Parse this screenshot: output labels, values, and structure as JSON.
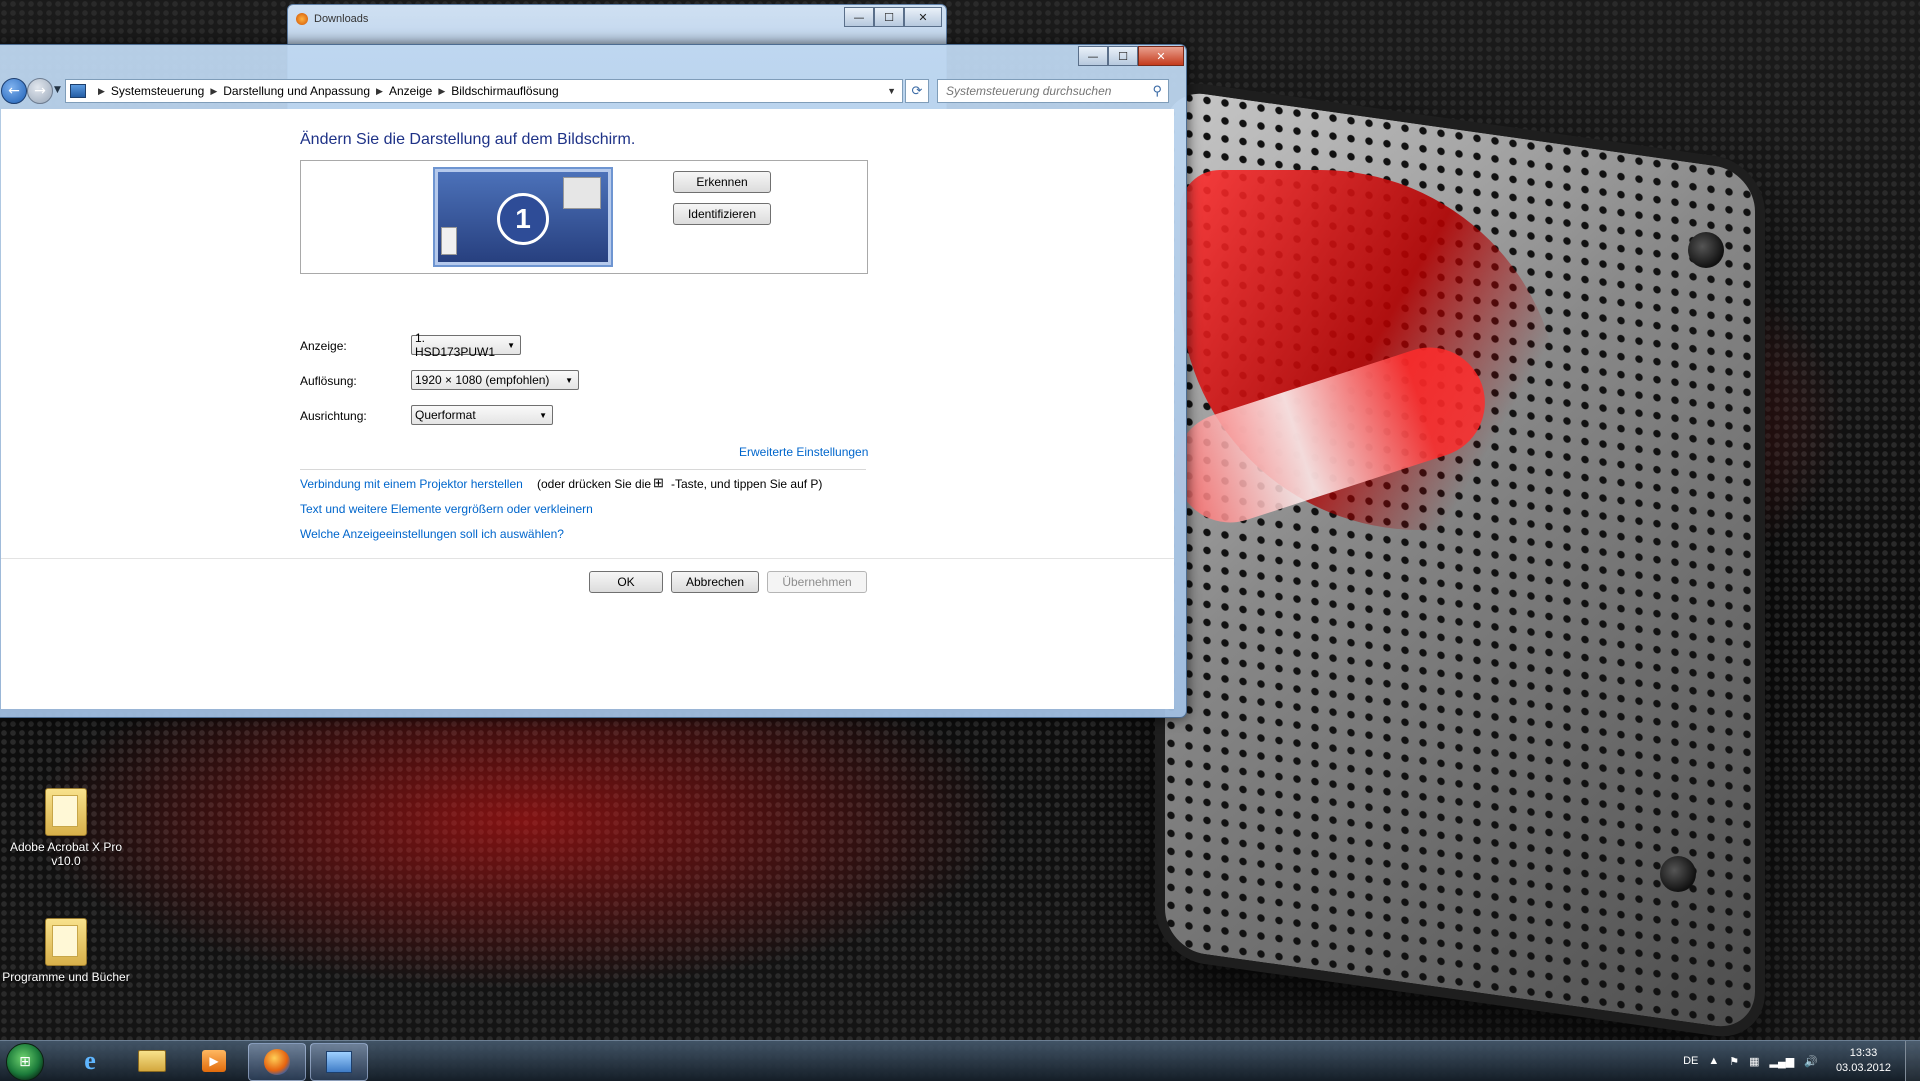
{
  "desktop": {
    "icons": [
      {
        "label": "Adobe Acrobat X Pro v10.0",
        "icon": "folder-icon"
      },
      {
        "label": "Programme und Bücher",
        "icon": "folder-icon"
      }
    ]
  },
  "downloads_window": {
    "title": "Downloads"
  },
  "window": {
    "caption": {
      "minimize": "—",
      "maximize": "☐",
      "close": "✕"
    },
    "nav": {
      "back": "←",
      "forward": "→"
    },
    "breadcrumb": [
      "Systemsteuerung",
      "Darstellung und Anpassung",
      "Anzeige",
      "Bildschirmauflösung"
    ],
    "search_placeholder": "Systemsteuerung durchsuchen",
    "heading": "Ändern Sie die Darstellung auf dem Bildschirm.",
    "preview": {
      "monitor_number": "1",
      "buttons": {
        "detect": "Erkennen",
        "identify": "Identifizieren"
      }
    },
    "fields": {
      "display": {
        "label": "Anzeige:",
        "value": "1. HSD173PUW1"
      },
      "resolution": {
        "label": "Auflösung:",
        "value": "1920 × 1080 (empfohlen)"
      },
      "orientation": {
        "label": "Ausrichtung:",
        "value": "Querformat"
      }
    },
    "advanced_link": "Erweiterte Einstellungen",
    "links": {
      "projector": "Verbindung mit einem Projektor herstellen",
      "projector_hint_1": "(oder drücken Sie die",
      "projector_hint_2": "-Taste, und tippen Sie auf P)",
      "text_size": "Text und weitere Elemente vergrößern oder verkleinern",
      "which_settings": "Welche Anzeigeeinstellungen soll ich auswählen?"
    },
    "buttons": {
      "ok": "OK",
      "cancel": "Abbrechen",
      "apply": "Übernehmen"
    }
  },
  "taskbar": {
    "items": [
      "start-orb-icon",
      "internet-explorer-icon",
      "explorer-folder-icon",
      "media-player-icon",
      "firefox-icon",
      "control-panel-icon"
    ],
    "tray": {
      "language": "DE",
      "time": "13:33",
      "date": "03.03.2012"
    }
  }
}
